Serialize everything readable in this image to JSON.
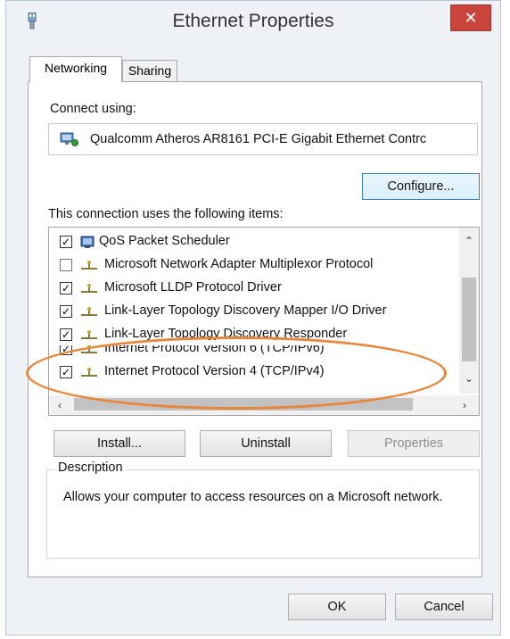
{
  "window": {
    "title": "Ethernet Properties",
    "close_glyph": "✕"
  },
  "tabs": [
    {
      "label": "Networking",
      "selected": true
    },
    {
      "label": "Sharing",
      "selected": false
    }
  ],
  "connect_using": {
    "label": "Connect using:",
    "adapter_name": "Qualcomm Atheros AR8161 PCI-E Gigabit Ethernet Contrc",
    "configure_button": "Configure..."
  },
  "items_section": {
    "label": "This connection uses the following items:",
    "items": [
      {
        "label": "QoS Packet Scheduler",
        "checked": true,
        "icon": "network-service-icon"
      },
      {
        "label": "Microsoft Network Adapter Multiplexor Protocol",
        "checked": false,
        "icon": "protocol-icon"
      },
      {
        "label": "Microsoft LLDP Protocol Driver",
        "checked": true,
        "icon": "protocol-icon"
      },
      {
        "label": "Link-Layer Topology Discovery Mapper I/O Driver",
        "checked": true,
        "icon": "protocol-icon"
      },
      {
        "label": "Link-Layer Topology Discovery Responder",
        "checked": true,
        "icon": "protocol-icon"
      },
      {
        "label": "Internet Protocol Version 6 (TCP/IPv6)",
        "checked": true,
        "icon": "protocol-icon"
      },
      {
        "label": "Internet Protocol Version 4 (TCP/IPv4)",
        "checked": true,
        "icon": "protocol-icon"
      }
    ],
    "highlight_color": "#e8863a"
  },
  "actions": {
    "install": "Install...",
    "uninstall": "Uninstall",
    "properties": "Properties"
  },
  "description": {
    "legend": "Description",
    "text": "Allows your computer to access resources on a Microsoft network."
  },
  "footer": {
    "ok": "OK",
    "cancel": "Cancel"
  },
  "colors": {
    "close_button": "#c9453b",
    "window_background": "#eef2f7"
  }
}
